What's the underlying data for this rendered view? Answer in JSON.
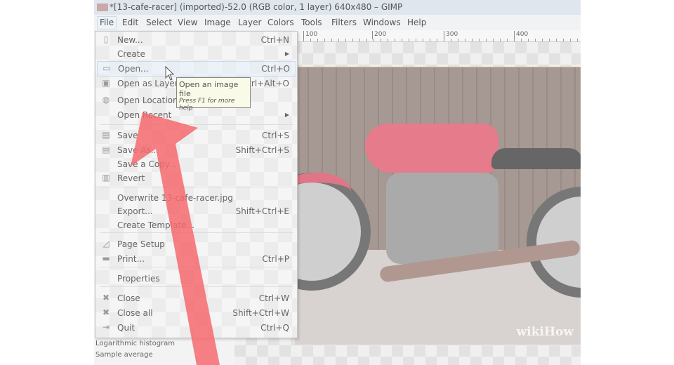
{
  "window": {
    "title": "*[13-cafe-racer] (imported)-52.0 (RGB color, 1 layer) 640x480 – GIMP"
  },
  "menubar": [
    "File",
    "Edit",
    "Select",
    "View",
    "Image",
    "Layer",
    "Colors",
    "Tools",
    "Filters",
    "Windows",
    "Help"
  ],
  "ruler": [
    "100",
    "200",
    "300",
    "400"
  ],
  "file_menu": [
    {
      "label": "New...",
      "shortcut": "Ctrl+N",
      "icon": "new-file-icon"
    },
    {
      "label": "Create",
      "shortcut": "",
      "submenu": true
    },
    {
      "label": "Open...",
      "shortcut": "Ctrl+O",
      "icon": "folder-icon",
      "highlighted": true
    },
    {
      "label": "Open as Layers...",
      "shortcut": "Ctrl+Alt+O",
      "icon": "open-layers-icon"
    },
    {
      "label": "Open Location...",
      "shortcut": "",
      "icon": "globe-icon"
    },
    {
      "label": "Open Recent",
      "shortcut": "",
      "submenu": true
    },
    {
      "label": "Save",
      "shortcut": "Ctrl+S",
      "icon": "save-icon"
    },
    {
      "label": "Save As...",
      "shortcut": "Shift+Ctrl+S",
      "icon": "save-as-icon"
    },
    {
      "label": "Save a Copy...",
      "shortcut": ""
    },
    {
      "label": "Revert",
      "shortcut": "",
      "icon": "revert-icon"
    },
    {
      "label": "Overwrite 13-cafe-racer.jpg",
      "shortcut": ""
    },
    {
      "label": "Export...",
      "shortcut": "Shift+Ctrl+E"
    },
    {
      "label": "Create Template...",
      "shortcut": ""
    },
    {
      "label": "Page Setup",
      "shortcut": "",
      "icon": "page-setup-icon"
    },
    {
      "label": "Print...",
      "shortcut": "Ctrl+P",
      "icon": "printer-icon"
    },
    {
      "label": "Properties",
      "shortcut": ""
    },
    {
      "label": "Close",
      "shortcut": "Ctrl+W",
      "icon": "close-icon"
    },
    {
      "label": "Close all",
      "shortcut": "Shift+Ctrl+W",
      "icon": "close-all-icon"
    },
    {
      "label": "Quit",
      "shortcut": "Ctrl+Q",
      "icon": "quit-icon"
    }
  ],
  "tooltip": {
    "title": "Open an image file",
    "hint": "Press F1 for more help"
  },
  "left_panel": {
    "option": "Logarithmic histogram",
    "label": "Sample average"
  },
  "watermark": "wikiHow",
  "colors": {
    "arrow": "#f46a6e",
    "accent": "#e57b8b"
  }
}
